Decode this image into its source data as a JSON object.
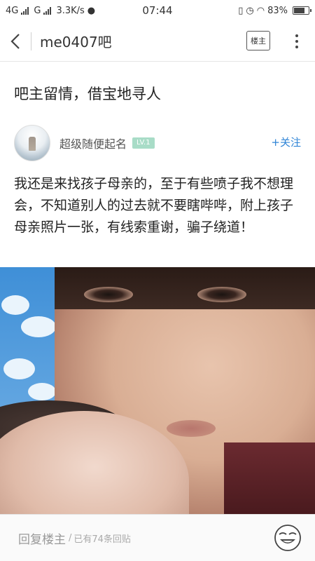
{
  "status": {
    "network": "4G",
    "network2": "G",
    "speed": "3.3K/s",
    "time": "07:44",
    "battery": "83%",
    "battery_level": 0.83
  },
  "header": {
    "forum_name": "me0407吧",
    "owner_button": "楼主"
  },
  "post": {
    "title": "吧主留情，借宝地寻人",
    "author": "超级随便起名",
    "level": "LV.1",
    "follow": "+关注",
    "body": "我还是来找孩子母亲的，至于有些喷子我不想理会，不知道别人的过去就不要瞎哔哔，附上孩子母亲照片一张，有线索重谢，骗子绕道！"
  },
  "reply_bar": {
    "reply_label": "回复楼主",
    "separator": "/",
    "reply_count": "已有74条回贴"
  },
  "icons": {
    "back": "back-arrow-icon",
    "more": "more-vertical-icon",
    "emoji": "emoji-face-icon"
  },
  "colors": {
    "accent": "#2f84d6",
    "level_badge": "#a8dcc7"
  }
}
